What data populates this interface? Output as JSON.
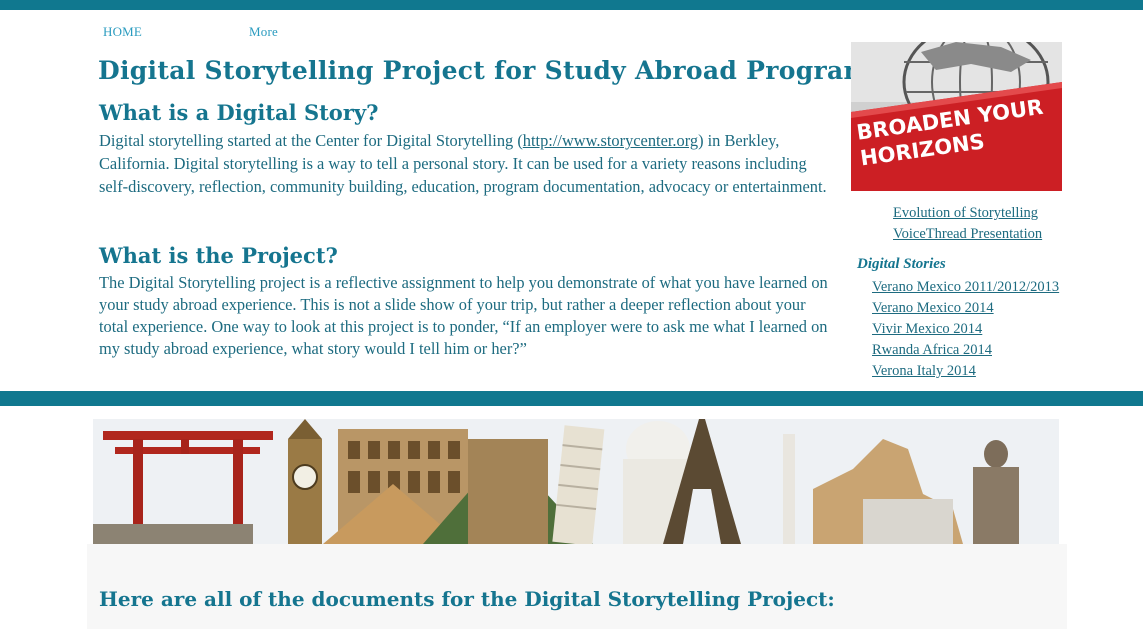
{
  "nav": {
    "home": "HOME",
    "more": "More"
  },
  "header": {
    "title": "Digital Storytelling Project for  Study Abroad Programs"
  },
  "sections": {
    "what_is_story": {
      "heading": "What is a Digital Story?",
      "text_before": "Digital storytelling started at the Center for Digital Storytelling (",
      "link": "http://www.storycenter.org",
      "text_after": ") in Berkley, California. Digital storytelling is a way to tell a personal story. It can be used for a variety reasons including self-discovery, reflection, community building, education, program documentation, advocacy or entertainment."
    },
    "what_is_project": {
      "heading": "What is the Project?",
      "text": "The Digital Storytelling project is a reflective assignment to help you demonstrate of what you have learned on your study abroad experience. This is not a slide show of your trip, but rather a deeper reflection about your total experience. One way to look at this project is to ponder, “If an employer were to ask me what I learned on my study abroad experience, what story would I tell him or her?”"
    }
  },
  "sidebar": {
    "image_text": [
      "BROADEN YOUR",
      "HORIZONS"
    ],
    "links": [
      "Evolution of Storytelling",
      "VoiceThread Presentation"
    ],
    "stories_heading": "Digital Stories",
    "stories": [
      "Verano Mexico 2011/2012/2013",
      "Verano Mexico 2014",
      "Vivir Mexico 2014",
      "Rwanda Africa 2014",
      "Verona Italy 2014"
    ]
  },
  "documents": {
    "heading": "Here are all of the documents for the Digital Storytelling Project:"
  },
  "colors": {
    "brand": "#10788f",
    "heading": "#15758f",
    "text": "#1d6b80",
    "nav": "#2a9bbf"
  }
}
